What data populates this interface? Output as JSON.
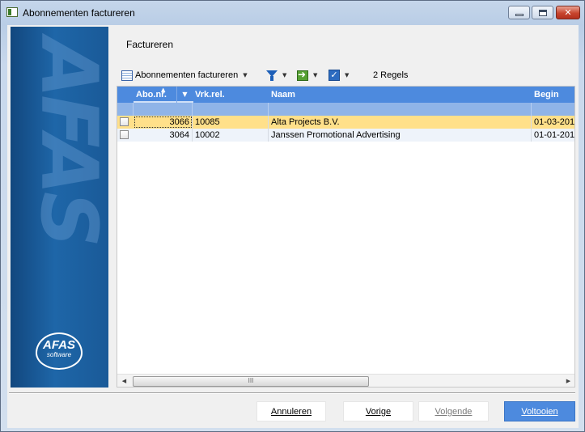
{
  "window": {
    "title": "Abonnementen factureren",
    "controls": {
      "minimize": "minimize-icon",
      "maximize": "maximize-icon",
      "close": "close-icon"
    }
  },
  "banner": {
    "logo_main": "AFAS",
    "logo_sub": "software",
    "watermark": "AFAS"
  },
  "heading": "Factureren",
  "toolbar": {
    "view_label": "Abonnementen factureren",
    "view_icon": "grid-view-icon",
    "filter_icon": "filter-icon",
    "action_icon": "green-arrow-icon",
    "check_icon": "checkbox-icon",
    "rows_count": "2 Regels"
  },
  "grid": {
    "columns": [
      "Abo.nr.",
      "Vrk.rel.",
      "Naam",
      "Begin"
    ],
    "rows": [
      {
        "abo": "3066",
        "rel": "10085",
        "naam": "Alta Projects B.V.",
        "begin": "01-03-201",
        "selected": true
      },
      {
        "abo": "3064",
        "rel": "10002",
        "naam": "Janssen Promotional Advertising",
        "begin": "01-01-201",
        "selected": false
      }
    ],
    "scroll_grip": "III"
  },
  "buttons": {
    "cancel": "Annuleren",
    "previous": "Vorige",
    "next": "Volgende",
    "finish": "Voltooien"
  },
  "colors": {
    "header": "#4d8ade",
    "selected_row": "#ffe08a",
    "banner": "#1e66a8"
  }
}
